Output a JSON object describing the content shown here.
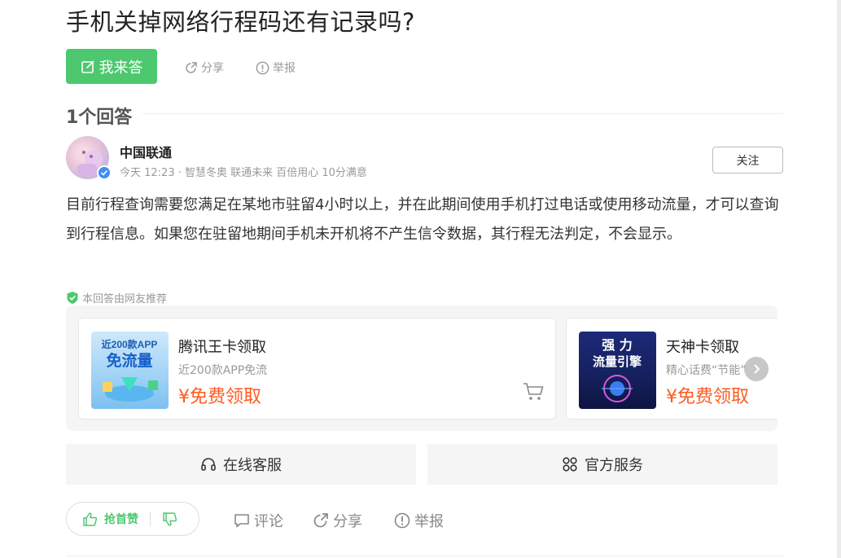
{
  "question": {
    "title": "手机关掉网络行程码还有记录吗?",
    "answer_label": "我来答",
    "share_label": "分享",
    "report_label": "举报"
  },
  "answers_header": {
    "count_label": "1个回答"
  },
  "answer": {
    "author": "中国联通",
    "meta": "今天 12:23 · 智慧冬奥 联通未来 百倍用心 10分满意",
    "follow_label": "关注",
    "body": "目前行程查询需要您满足在某地市驻留4小时以上，并在此期间使用手机打过电话或使用移动流量，才可以查询到行程信息。如果您在驻留地期间手机未开机将不产生信令数据，其行程无法判定，不会显示。",
    "recommend_label": "本回答由网友推荐"
  },
  "products": [
    {
      "name": "腾讯王卡领取",
      "desc": "近200款APP免流",
      "price": "¥免费领取",
      "img_line1": "近200款APP",
      "img_line2": "免流量"
    },
    {
      "name": "天神卡领取",
      "desc": "精心话费“节能”",
      "price": "¥免费领取",
      "img_line1": "强  力",
      "img_line2": "流量引擎"
    }
  ],
  "services": {
    "online_label": "在线客服",
    "official_label": "官方服务"
  },
  "actions": {
    "upvote_label": "抢首赞",
    "comment_label": "评论",
    "share_label": "分享",
    "report_label": "举报"
  },
  "colors": {
    "accent_green": "#4dc86f",
    "price_orange": "#ff5a1f",
    "verified_blue": "#3e8ef7"
  },
  "icons": [
    "edit-icon",
    "share-icon",
    "report-icon",
    "verified-icon",
    "shield-check-icon",
    "cart-icon",
    "chevron-right-icon",
    "headset-icon",
    "grid-icon",
    "thumb-up-icon",
    "thumb-down-icon",
    "comment-icon"
  ]
}
